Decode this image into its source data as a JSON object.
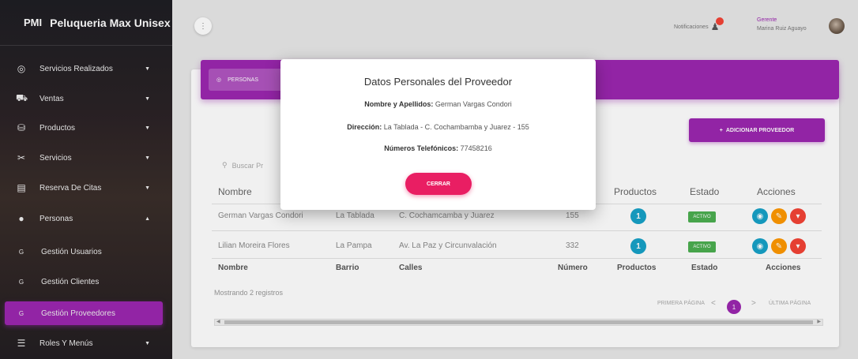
{
  "brand": {
    "short": "PMI",
    "name": "Peluqueria Max Unisex"
  },
  "sidebar": {
    "items": [
      {
        "label": "Servicios Realizados"
      },
      {
        "label": "Ventas"
      },
      {
        "label": "Productos"
      },
      {
        "label": "Servicios"
      },
      {
        "label": "Reserva De Citas"
      },
      {
        "label": "Personas"
      },
      {
        "label": "Gestión Usuarios",
        "prefix": "G"
      },
      {
        "label": "Gestión Clientes",
        "prefix": "G"
      },
      {
        "label": "Gestión Proveedores",
        "prefix": "G"
      },
      {
        "label": "Roles Y Menús"
      }
    ]
  },
  "topbar": {
    "notifications_label": "Notificaciones",
    "user_role": "Gerente",
    "user_name": "Marina Ruiz Aguayo"
  },
  "card": {
    "tab_label": "PERSONAS",
    "add_button": "ADICIONAR PROVEEDOR",
    "search_placeholder": "Buscar Pr"
  },
  "table": {
    "headers": [
      "Nombre",
      "Barrio",
      "Calles",
      "Número",
      "Productos",
      "Estado",
      "Acciones"
    ],
    "rows": [
      {
        "nombre": "German Vargas Condori",
        "barrio": "La Tablada",
        "calles": "C. Cochamcamba y Juarez",
        "numero": "155",
        "productos": "1",
        "estado": "ACTIVO"
      },
      {
        "nombre": "Lilian Moreira Flores",
        "barrio": "La Pampa",
        "calles": "Av. La Paz y Circunvalación",
        "numero": "332",
        "productos": "1",
        "estado": "ACTIVO"
      }
    ],
    "footer": [
      "Nombre",
      "Barrio",
      "Calles",
      "Número",
      "Productos",
      "Estado",
      "Acciones"
    ],
    "showing": "Mostrando 2 registros"
  },
  "pagination": {
    "first": "PRIMERA PÁGINA",
    "current": "1",
    "last": "ÚLTIMA PÁGINA",
    "prev": "<",
    "next": ">"
  },
  "modal": {
    "title": "Datos Personales del Proveedor",
    "name_label": "Nombre y Apellidos:",
    "name_value": "German Vargas Condori",
    "address_label": "Dirección:",
    "address_value": "La Tablada - C. Cochambamba y Juarez - 155",
    "phone_label": "Números Telefónicos:",
    "phone_value": "77458216",
    "close_button": "CERRAR"
  }
}
